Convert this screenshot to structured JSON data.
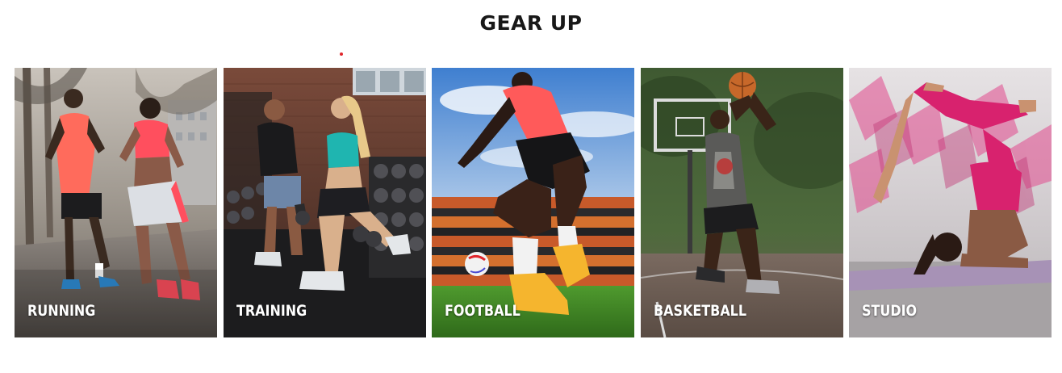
{
  "section": {
    "title": "GEAR UP"
  },
  "categories": [
    {
      "label": "RUNNING"
    },
    {
      "label": "TRAINING"
    },
    {
      "label": "FOOTBALL"
    },
    {
      "label": "BASKETBALL"
    },
    {
      "label": "STUDIO"
    }
  ],
  "colors": {
    "title": "#181818",
    "accent": "#e0262c",
    "label": "#ffffff"
  }
}
